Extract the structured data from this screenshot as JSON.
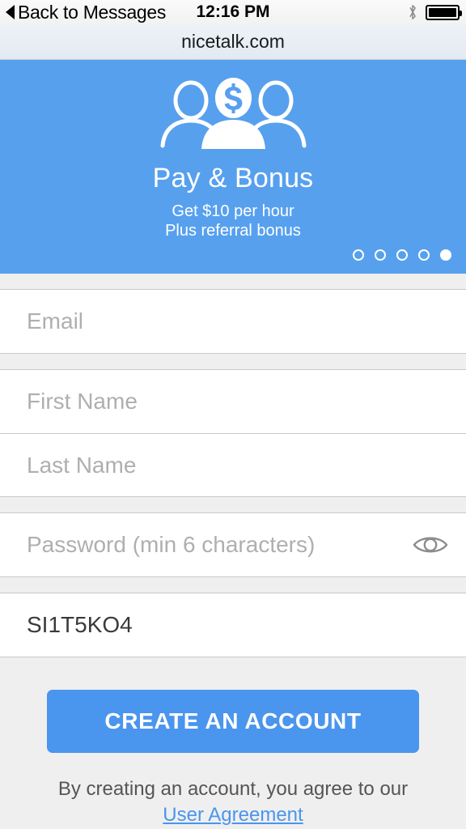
{
  "status_bar": {
    "back_label": "Back to Messages",
    "time": "12:16 PM",
    "bluetooth_icon": "bluetooth-icon",
    "battery_icon": "battery-full-icon"
  },
  "browser": {
    "host": "nicetalk.com"
  },
  "hero": {
    "icon": "group-of-people-with-dollar-icon",
    "title": "Pay & Bonus",
    "subtitle_line1": "Get $10 per hour",
    "subtitle_line2": "Plus referral bonus",
    "background_color": "#57A0EE",
    "carousel": {
      "total": 5,
      "active_index": 4
    }
  },
  "form": {
    "email": {
      "placeholder": "Email",
      "value": ""
    },
    "first_name": {
      "placeholder": "First Name",
      "value": ""
    },
    "last_name": {
      "placeholder": "Last Name",
      "value": ""
    },
    "password": {
      "placeholder": "Password (min 6 characters)",
      "value": "",
      "reveal_icon": "eye-icon"
    },
    "code": {
      "placeholder": "",
      "value": "SI1T5KO4"
    }
  },
  "cta": {
    "label": "CREATE AN ACCOUNT",
    "color": "#4A95EE"
  },
  "footer": {
    "text": "By creating an account, you agree to our",
    "link_label": "User Agreement",
    "link_color": "#4A95EE"
  }
}
